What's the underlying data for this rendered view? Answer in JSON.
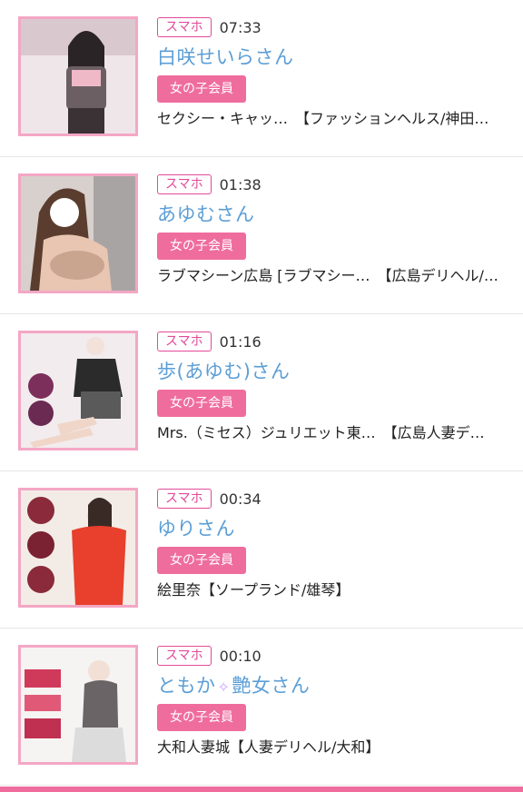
{
  "items": [
    {
      "device": "スマホ",
      "time": "07:33",
      "name": "白咲せいらさん",
      "badge": "女の子会員",
      "shop": "セクシー・キャッ…　【ファッションヘルス/神田…",
      "thumb_icon": "portrait-photo-icon"
    },
    {
      "device": "スマホ",
      "time": "01:38",
      "name": "あゆむさん",
      "badge": "女の子会員",
      "shop": "ラブマシーン広島 [ラブマシー…　【広島デリヘル/…",
      "thumb_icon": "portrait-photo-icon"
    },
    {
      "device": "スマホ",
      "time": "01:16",
      "name": "歩(あゆむ)さん",
      "badge": "女の子会員",
      "shop": "Mrs.（ミセス）ジュリエット東…　【広島人妻デ…",
      "thumb_icon": "portrait-photo-icon"
    },
    {
      "device": "スマホ",
      "time": "00:34",
      "name": "ゆりさん",
      "badge": "女の子会員",
      "shop": "絵里奈【ソープランド/雄琴】",
      "thumb_icon": "portrait-photo-icon"
    },
    {
      "device": "スマホ",
      "time": "00:10",
      "name_before": "ともか",
      "name_after": "艶女さん",
      "badge": "女の子会員",
      "shop": "大和人妻城【人妻デリヘル/大和】",
      "thumb_icon": "portrait-photo-icon"
    }
  ],
  "colors": {
    "device_badge": "#e24a9a",
    "name": "#5b9ed6",
    "member_badge": "#ef6d9d",
    "thumb_border": "#f4a7c4"
  }
}
